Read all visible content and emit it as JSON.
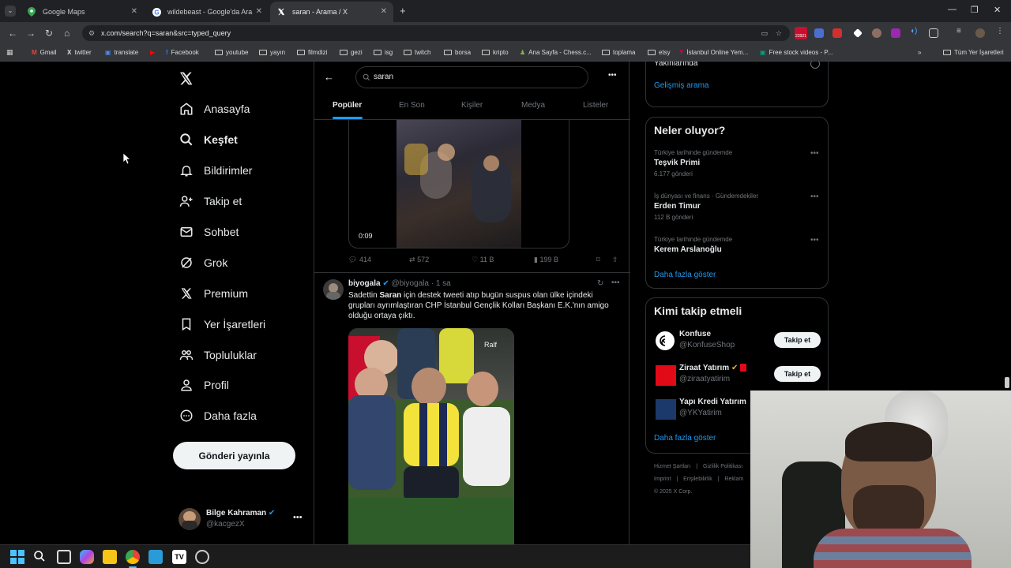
{
  "browser": {
    "tabs": [
      {
        "title": "Google Maps",
        "active": false
      },
      {
        "title": "wildebeast - Google'da Ara",
        "active": false
      },
      {
        "title": "saran - Arama / X",
        "active": true
      }
    ],
    "url": "x.com/search?q=saran&src=typed_query",
    "badge": "23921",
    "bookmarks": [
      "Gmail",
      "twitter",
      "translate",
      "Facebook",
      "youtube",
      "yayın",
      "filmdizi",
      "gezi",
      "isg",
      "twitch",
      "borsa",
      "kripto",
      "Ana Sayfa - Chess.c...",
      "toplama",
      "etsy",
      "İstanbul Online Yem...",
      "Free stock videos - P...",
      "Tüm Yer İşaretleri"
    ]
  },
  "nav": {
    "items": [
      {
        "label": "Anasayfa",
        "icon": "home-icon"
      },
      {
        "label": "Keşfet",
        "icon": "search-icon"
      },
      {
        "label": "Bildirimler",
        "icon": "bell-icon"
      },
      {
        "label": "Takip et",
        "icon": "add-person-icon"
      },
      {
        "label": "Sohbet",
        "icon": "mail-icon"
      },
      {
        "label": "Grok",
        "icon": "grok-icon"
      },
      {
        "label": "Premium",
        "icon": "x-logo-icon"
      },
      {
        "label": "Yer İşaretleri",
        "icon": "bookmark-icon"
      },
      {
        "label": "Topluluklar",
        "icon": "communities-icon"
      },
      {
        "label": "Profil",
        "icon": "person-icon"
      },
      {
        "label": "Daha fazla",
        "icon": "more-circle-icon"
      }
    ],
    "post_button": "Gönderi yayınla",
    "account": {
      "name": "Bilge Kahraman",
      "handle": "@kacgezX"
    }
  },
  "search": {
    "query": "saran",
    "tabs": [
      "Popüler",
      "En Son",
      "Kişiler",
      "Medya",
      "Listeler"
    ],
    "active_tab": "Popüler"
  },
  "tweet1": {
    "video_duration": "0:09",
    "replies": "414",
    "retweets": "572",
    "likes": "11 B",
    "views": "199 B"
  },
  "tweet2": {
    "author": "biyogala",
    "handle": "@biyogala",
    "time": "· 1 sa",
    "text_pre": "Sadettin ",
    "text_bold": "Saran",
    "text_post": " için destek tweeti atıp bugün suspus olan ülke içindeki grupları ayrımlaştıran CHP İstanbul Gençlik Kolları Başkanı E.K.'nın amigo olduğu ortaya çıktı."
  },
  "right": {
    "partial_label": "Yakınlarında",
    "advanced_search": "Gelişmiş arama",
    "trends_title": "Neler oluyor?",
    "trends": [
      {
        "meta": "Türkiye tarihinde gündemde",
        "title": "Teşvik Primi",
        "count": "6.177 gönderi"
      },
      {
        "meta": "İş dünyası ve finans · Gündemdekiler",
        "title": "Erden Timur",
        "count": "112 B gönderi"
      },
      {
        "meta": "Türkiye tarihinde gündemde",
        "title": "Kerem Arslanoğlu",
        "count": ""
      }
    ],
    "show_more": "Daha fazla göster",
    "who_title": "Kimi takip etmeli",
    "who": [
      {
        "name": "Konfuse",
        "handle": "@KonfuseShop",
        "button": "Takip et"
      },
      {
        "name": "Ziraat Yatırım",
        "handle": "@ziraatyatirim",
        "button": "Takip et"
      },
      {
        "name": "Yapı Kredi Yatırım",
        "handle": "@YKYatirim",
        "button": ""
      }
    ],
    "who_more": "Daha fazla göster",
    "footer": [
      "Hizmet Şartları",
      "Gizlilik Politikası",
      "Imprint",
      "Erişilebilirlik",
      "Reklam",
      "© 2025 X Corp."
    ]
  }
}
